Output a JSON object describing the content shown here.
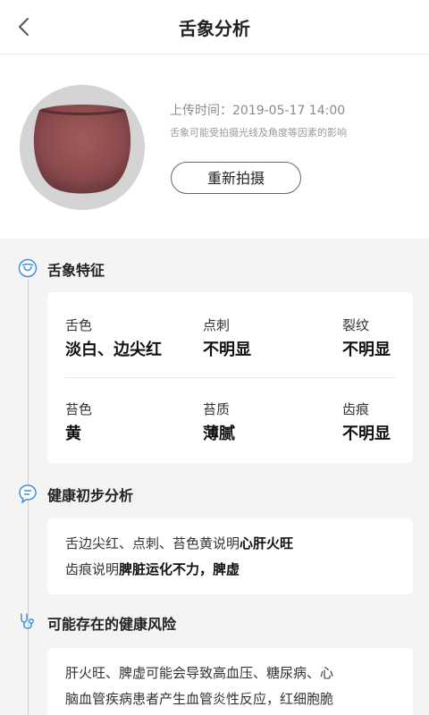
{
  "nav": {
    "title": "舌象分析"
  },
  "upload": {
    "time_label": "上传时间：",
    "time_value": "2019-05-17 14:00",
    "note": "舌象可能受拍摄光线及角度等因素的影响",
    "retake_label": "重新拍摄"
  },
  "features": {
    "title": "舌象特征",
    "items": [
      {
        "label": "舌色",
        "value": "淡白、边尖红"
      },
      {
        "label": "点刺",
        "value": "不明显"
      },
      {
        "label": "裂纹",
        "value": "不明显"
      },
      {
        "label": "苔色",
        "value": "黄"
      },
      {
        "label": "苔质",
        "value": "薄腻"
      },
      {
        "label": "齿痕",
        "value": "不明显"
      }
    ]
  },
  "analysis": {
    "title": "健康初步分析",
    "line1_plain": "舌边尖红、点刺、苔色黄说明",
    "line1_bold": "心肝火旺",
    "line2_plain": "齿痕说明",
    "line2_bold": "脾脏运化不力，脾虚"
  },
  "risk": {
    "title": "可能存在的健康风险",
    "line1": "肝火旺、脾虚可能会导致高血压、糖尿病、心",
    "line2": "脑血管疾病患者产生血管炎性反应，红细胞脆"
  }
}
